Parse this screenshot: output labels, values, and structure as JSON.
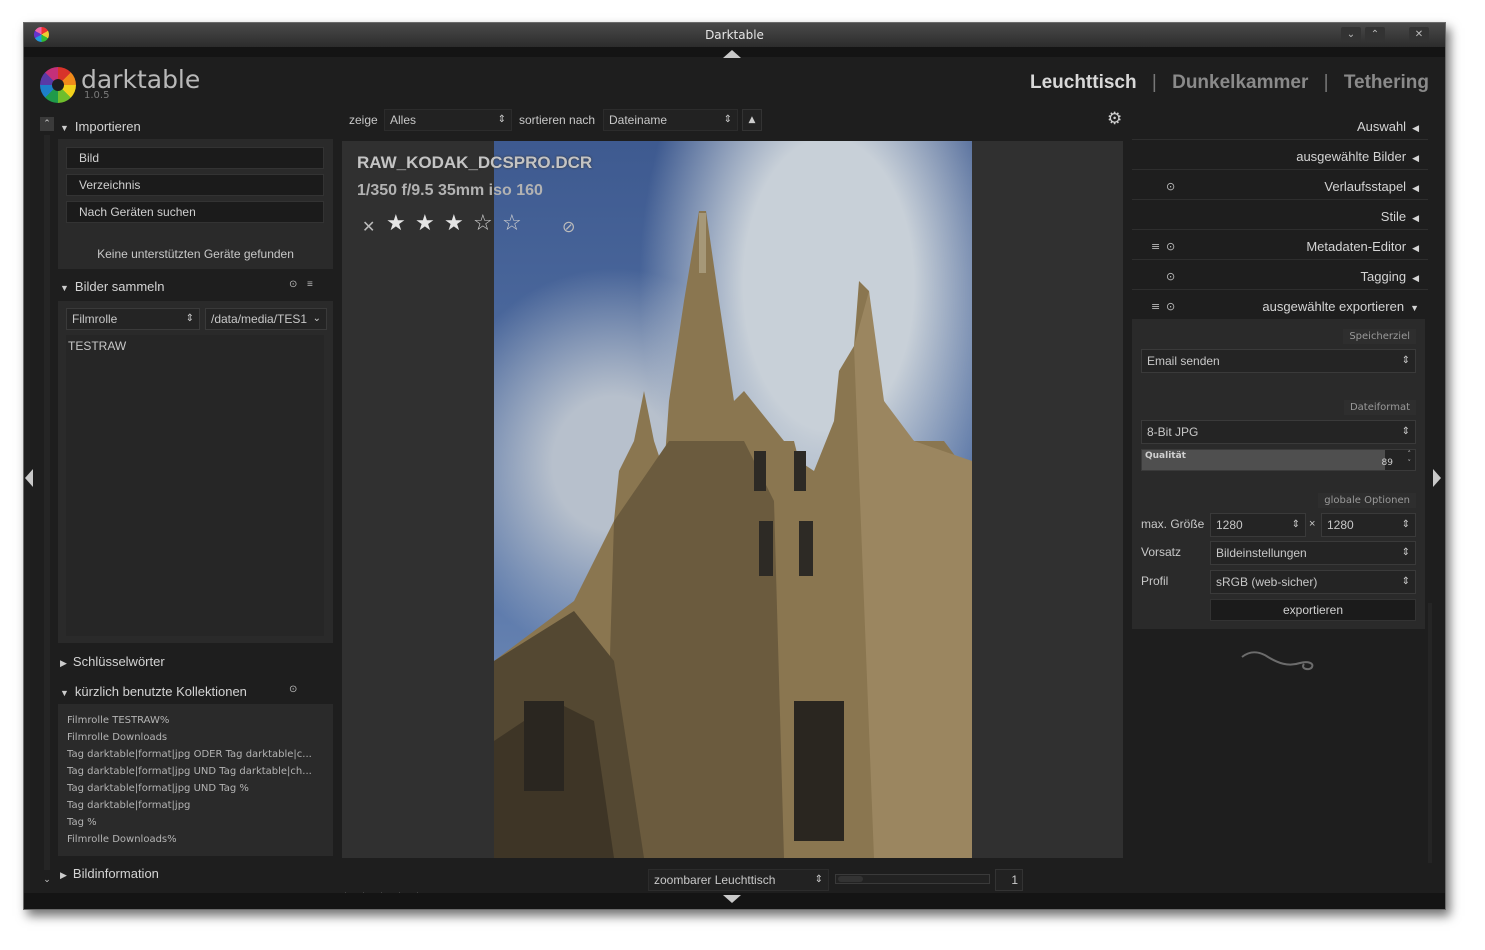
{
  "window": {
    "title": "Darktable"
  },
  "app": {
    "name": "darktable",
    "version": "1.0.5"
  },
  "views": {
    "lighttable": "Leuchttisch",
    "darkroom": "Dunkelkammer",
    "tethering": "Tethering",
    "separator": "|"
  },
  "filterbar": {
    "show_label": "zeige",
    "show_value": "Alles",
    "sort_label": "sortieren nach",
    "sort_value": "Dateiname",
    "sort_dir_icon": "▲"
  },
  "left": {
    "import": {
      "title": "Importieren",
      "buttons": [
        "Bild",
        "Verzeichnis",
        "Nach Geräten suchen"
      ],
      "status": "Keine unterstützten Geräte gefunden"
    },
    "collect": {
      "title": "Bilder sammeln",
      "property": "Filmrolle",
      "path": "/data/media/TES1",
      "items": [
        "TESTRAW"
      ]
    },
    "keywords": {
      "title": "Schlüsselwörter"
    },
    "recent": {
      "title": "kürzlich benutzte Kollektionen",
      "items": [
        "Filmrolle TESTRAW%",
        "Filmrolle Downloads",
        "Tag darktable|format|jpg ODER Tag darktable|c...",
        "Tag darktable|format|jpg UND Tag darktable|ch...",
        "Tag darktable|format|jpg UND Tag %",
        "Tag darktable|format|jpg",
        "Tag %",
        "Filmrolle Downloads%"
      ]
    },
    "imageinfo": {
      "title": "Bildinformation"
    }
  },
  "image": {
    "filename": "RAW_KODAK_DCSPRO.DCR",
    "exif": "1/350 f/9.5 35mm iso 160",
    "rating": 3,
    "max_rating": 5,
    "reject_icon": "✕"
  },
  "right": {
    "modules": [
      "Auswahl",
      "ausgewählte Bilder",
      "Verlaufsstapel",
      "Stile",
      "Metadaten-Editor",
      "Tagging",
      "ausgewählte exportieren"
    ],
    "export": {
      "target_label": "Speicherziel",
      "target_value": "Email senden",
      "format_label": "Dateiformat",
      "format_value": "8-Bit JPG",
      "quality_label": "Qualität",
      "quality_value": "89",
      "quality_level": 0.89,
      "global_label": "globale Optionen",
      "maxsize_label": "max. Größe",
      "width": "1280",
      "height": "1280",
      "times": "×",
      "preset_label": "Vorsatz",
      "preset_value": "Bildeinstellungen",
      "profile_label": "Profil",
      "profile_value": "sRGB (web-sicher)",
      "export_button": "exportieren"
    }
  },
  "bottom": {
    "layout_value": "zoombarer Leuchttisch",
    "zoom_value": "1",
    "color_labels": [
      "#c62828",
      "#c9b10f",
      "#2e9e2e",
      "#2343c8",
      "#a528b8",
      "#bdbdbd"
    ]
  }
}
